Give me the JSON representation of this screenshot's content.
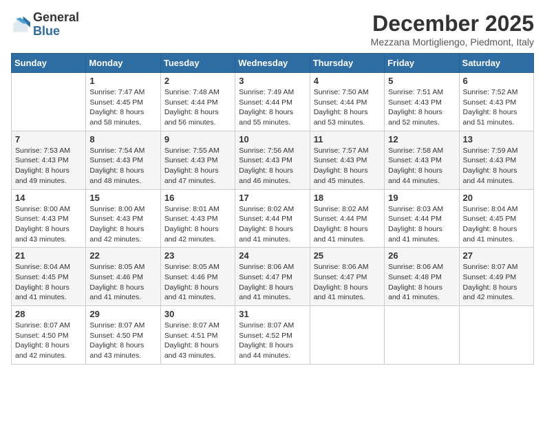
{
  "header": {
    "logo_general": "General",
    "logo_blue": "Blue",
    "month_title": "December 2025",
    "subtitle": "Mezzana Mortigliengo, Piedmont, Italy"
  },
  "calendar": {
    "days": [
      "Sunday",
      "Monday",
      "Tuesday",
      "Wednesday",
      "Thursday",
      "Friday",
      "Saturday"
    ],
    "weeks": [
      [
        {
          "day": "",
          "sunrise": "",
          "sunset": "",
          "daylight": ""
        },
        {
          "day": "1",
          "sunrise": "Sunrise: 7:47 AM",
          "sunset": "Sunset: 4:45 PM",
          "daylight": "Daylight: 8 hours and 58 minutes."
        },
        {
          "day": "2",
          "sunrise": "Sunrise: 7:48 AM",
          "sunset": "Sunset: 4:44 PM",
          "daylight": "Daylight: 8 hours and 56 minutes."
        },
        {
          "day": "3",
          "sunrise": "Sunrise: 7:49 AM",
          "sunset": "Sunset: 4:44 PM",
          "daylight": "Daylight: 8 hours and 55 minutes."
        },
        {
          "day": "4",
          "sunrise": "Sunrise: 7:50 AM",
          "sunset": "Sunset: 4:44 PM",
          "daylight": "Daylight: 8 hours and 53 minutes."
        },
        {
          "day": "5",
          "sunrise": "Sunrise: 7:51 AM",
          "sunset": "Sunset: 4:43 PM",
          "daylight": "Daylight: 8 hours and 52 minutes."
        },
        {
          "day": "6",
          "sunrise": "Sunrise: 7:52 AM",
          "sunset": "Sunset: 4:43 PM",
          "daylight": "Daylight: 8 hours and 51 minutes."
        }
      ],
      [
        {
          "day": "7",
          "sunrise": "Sunrise: 7:53 AM",
          "sunset": "Sunset: 4:43 PM",
          "daylight": "Daylight: 8 hours and 49 minutes."
        },
        {
          "day": "8",
          "sunrise": "Sunrise: 7:54 AM",
          "sunset": "Sunset: 4:43 PM",
          "daylight": "Daylight: 8 hours and 48 minutes."
        },
        {
          "day": "9",
          "sunrise": "Sunrise: 7:55 AM",
          "sunset": "Sunset: 4:43 PM",
          "daylight": "Daylight: 8 hours and 47 minutes."
        },
        {
          "day": "10",
          "sunrise": "Sunrise: 7:56 AM",
          "sunset": "Sunset: 4:43 PM",
          "daylight": "Daylight: 8 hours and 46 minutes."
        },
        {
          "day": "11",
          "sunrise": "Sunrise: 7:57 AM",
          "sunset": "Sunset: 4:43 PM",
          "daylight": "Daylight: 8 hours and 45 minutes."
        },
        {
          "day": "12",
          "sunrise": "Sunrise: 7:58 AM",
          "sunset": "Sunset: 4:43 PM",
          "daylight": "Daylight: 8 hours and 44 minutes."
        },
        {
          "day": "13",
          "sunrise": "Sunrise: 7:59 AM",
          "sunset": "Sunset: 4:43 PM",
          "daylight": "Daylight: 8 hours and 44 minutes."
        }
      ],
      [
        {
          "day": "14",
          "sunrise": "Sunrise: 8:00 AM",
          "sunset": "Sunset: 4:43 PM",
          "daylight": "Daylight: 8 hours and 43 minutes."
        },
        {
          "day": "15",
          "sunrise": "Sunrise: 8:00 AM",
          "sunset": "Sunset: 4:43 PM",
          "daylight": "Daylight: 8 hours and 42 minutes."
        },
        {
          "day": "16",
          "sunrise": "Sunrise: 8:01 AM",
          "sunset": "Sunset: 4:43 PM",
          "daylight": "Daylight: 8 hours and 42 minutes."
        },
        {
          "day": "17",
          "sunrise": "Sunrise: 8:02 AM",
          "sunset": "Sunset: 4:44 PM",
          "daylight": "Daylight: 8 hours and 41 minutes."
        },
        {
          "day": "18",
          "sunrise": "Sunrise: 8:02 AM",
          "sunset": "Sunset: 4:44 PM",
          "daylight": "Daylight: 8 hours and 41 minutes."
        },
        {
          "day": "19",
          "sunrise": "Sunrise: 8:03 AM",
          "sunset": "Sunset: 4:44 PM",
          "daylight": "Daylight: 8 hours and 41 minutes."
        },
        {
          "day": "20",
          "sunrise": "Sunrise: 8:04 AM",
          "sunset": "Sunset: 4:45 PM",
          "daylight": "Daylight: 8 hours and 41 minutes."
        }
      ],
      [
        {
          "day": "21",
          "sunrise": "Sunrise: 8:04 AM",
          "sunset": "Sunset: 4:45 PM",
          "daylight": "Daylight: 8 hours and 41 minutes."
        },
        {
          "day": "22",
          "sunrise": "Sunrise: 8:05 AM",
          "sunset": "Sunset: 4:46 PM",
          "daylight": "Daylight: 8 hours and 41 minutes."
        },
        {
          "day": "23",
          "sunrise": "Sunrise: 8:05 AM",
          "sunset": "Sunset: 4:46 PM",
          "daylight": "Daylight: 8 hours and 41 minutes."
        },
        {
          "day": "24",
          "sunrise": "Sunrise: 8:06 AM",
          "sunset": "Sunset: 4:47 PM",
          "daylight": "Daylight: 8 hours and 41 minutes."
        },
        {
          "day": "25",
          "sunrise": "Sunrise: 8:06 AM",
          "sunset": "Sunset: 4:47 PM",
          "daylight": "Daylight: 8 hours and 41 minutes."
        },
        {
          "day": "26",
          "sunrise": "Sunrise: 8:06 AM",
          "sunset": "Sunset: 4:48 PM",
          "daylight": "Daylight: 8 hours and 41 minutes."
        },
        {
          "day": "27",
          "sunrise": "Sunrise: 8:07 AM",
          "sunset": "Sunset: 4:49 PM",
          "daylight": "Daylight: 8 hours and 42 minutes."
        }
      ],
      [
        {
          "day": "28",
          "sunrise": "Sunrise: 8:07 AM",
          "sunset": "Sunset: 4:50 PM",
          "daylight": "Daylight: 8 hours and 42 minutes."
        },
        {
          "day": "29",
          "sunrise": "Sunrise: 8:07 AM",
          "sunset": "Sunset: 4:50 PM",
          "daylight": "Daylight: 8 hours and 43 minutes."
        },
        {
          "day": "30",
          "sunrise": "Sunrise: 8:07 AM",
          "sunset": "Sunset: 4:51 PM",
          "daylight": "Daylight: 8 hours and 43 minutes."
        },
        {
          "day": "31",
          "sunrise": "Sunrise: 8:07 AM",
          "sunset": "Sunset: 4:52 PM",
          "daylight": "Daylight: 8 hours and 44 minutes."
        },
        {
          "day": "",
          "sunrise": "",
          "sunset": "",
          "daylight": ""
        },
        {
          "day": "",
          "sunrise": "",
          "sunset": "",
          "daylight": ""
        },
        {
          "day": "",
          "sunrise": "",
          "sunset": "",
          "daylight": ""
        }
      ]
    ]
  }
}
